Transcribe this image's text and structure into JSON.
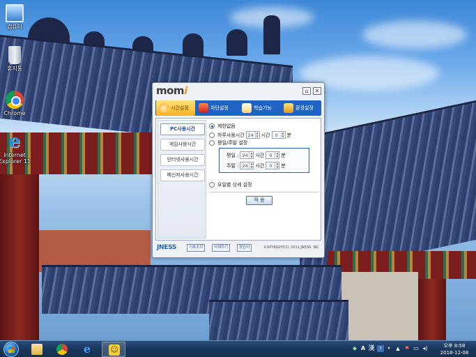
{
  "desktop": {
    "icons": [
      {
        "label": "컴퓨터",
        "icon": "computer-icon"
      },
      {
        "label": "휴지통",
        "icon": "recycle-bin-icon"
      },
      {
        "label": "Chrome",
        "icon": "chrome-icon"
      },
      {
        "label": "Internet Explorer 11",
        "icon": "internet-explorer-icon"
      }
    ]
  },
  "app": {
    "logo_main": "mom",
    "logo_accent": "i",
    "title_buttons": {
      "home": "⌂",
      "close": "✕"
    },
    "tabs": [
      {
        "label": "시간설정",
        "icon": "clock-tab-icon",
        "active": true
      },
      {
        "label": "차단설정",
        "icon": "block-tab-icon",
        "active": false
      },
      {
        "label": "학습기능",
        "icon": "book-tab-icon",
        "active": false
      },
      {
        "label": "환경설정",
        "icon": "settings-tab-icon",
        "active": false
      }
    ],
    "sidebar": [
      {
        "label": "PC사용시간",
        "active": true
      },
      {
        "label": "게임사용시간",
        "active": false
      },
      {
        "label": "인터넷사용시간",
        "active": false
      },
      {
        "label": "메신저사용시간",
        "active": false
      }
    ],
    "options": {
      "unlimited": "제한없음",
      "daily_limit": "하루사용시간",
      "daily_hours": "24",
      "hours_unit": "시간",
      "daily_minutes": "0",
      "minutes_unit": "분",
      "weekday_weekend": "평일/주말 설정",
      "weekday_label": "평일 :",
      "weekday_hours": "24",
      "weekday_minutes": "0",
      "weekend_label": "주말 :",
      "weekend_hours": "24",
      "weekend_minutes": "0",
      "per_day": "요일별 상세 설정",
      "selected": "unlimited"
    },
    "apply_label": "적 용",
    "footer": {
      "brand": "JNESS",
      "buttons": [
        "기록조회",
        "삭제하기",
        "창관리"
      ],
      "copyright": "COPYRIGHT(C) 2011 JNESS. INC"
    }
  },
  "taskbar": {
    "pinned": [
      {
        "icon": "folder-icon",
        "active": false
      },
      {
        "icon": "chrome-icon",
        "active": false
      },
      {
        "icon": "internet-explorer-icon",
        "active": false
      },
      {
        "icon": "momi-icon",
        "active": true
      }
    ],
    "tray": {
      "ime_letter": "A",
      "ime_hanja": "漢",
      "period": "오후",
      "time": "8:58",
      "date": "2018-12-08"
    }
  }
}
